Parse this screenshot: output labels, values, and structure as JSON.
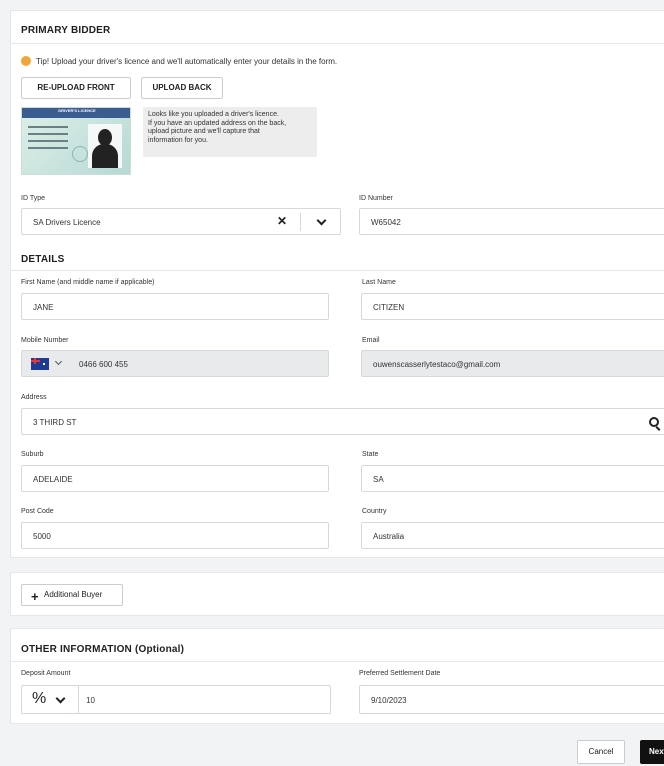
{
  "primary_bidder": {
    "title": "PRIMARY BIDDER",
    "tip": "Tip! Upload your driver's licence and we'll automatically enter your details in the form.",
    "reupload_front_label": "RE-UPLOAD FRONT",
    "upload_back_label": "UPLOAD BACK",
    "licence_header": "DRIVER'S LICENCE",
    "licence_note": [
      "Looks like you uploaded a driver's licence.",
      "If you have an updated address on the back,",
      "upload picture and we'll capture that",
      "information for you."
    ],
    "id_type_label": "ID Type",
    "id_type_value": "SA Drivers Licence",
    "id_number_label": "ID Number",
    "id_number_value": "W65042"
  },
  "details": {
    "title": "DETAILS",
    "first_name_label": "First Name (and middle name if applicable)",
    "first_name_value": "JANE",
    "last_name_label": "Last Name",
    "last_name_value": "CITIZEN",
    "mobile_label": "Mobile Number",
    "mobile_value": "0466 600 455",
    "email_label": "Email",
    "email_value": "ouwenscasserlytestaco@gmail.com",
    "address_label": "Address",
    "address_value": "3 THIRD ST",
    "suburb_label": "Suburb",
    "suburb_value": "ADELAIDE",
    "state_label": "State",
    "state_value": "SA",
    "postcode_label": "Post Code",
    "postcode_value": "5000",
    "country_label": "Country",
    "country_value": "Australia"
  },
  "additional_buyer_label": "Additional Buyer",
  "other_info": {
    "title": "OTHER INFORMATION (Optional)",
    "deposit_label": "Deposit Amount",
    "deposit_unit": "%",
    "deposit_value": "10",
    "settlement_label": "Preferred Settlement Date",
    "settlement_value": "9/10/2023"
  },
  "footer": {
    "cancel_label": "Cancel",
    "next_label": "Next"
  },
  "colors": {
    "tip_icon": "#f0a73a",
    "next_button": "#111111"
  }
}
